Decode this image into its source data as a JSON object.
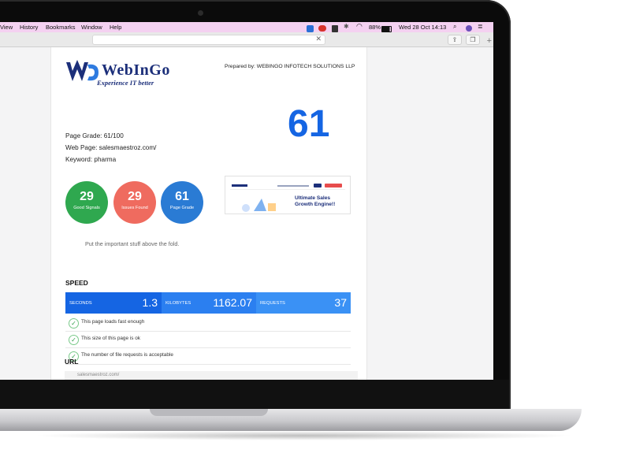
{
  "menubar": {
    "items": [
      "View",
      "History",
      "Bookmarks",
      "Window",
      "Help"
    ],
    "battery": "88%",
    "datetime": "Wed 28 Oct  14:13"
  },
  "browser": {
    "address_value": "",
    "close_glyph": "✕",
    "share_glyph": "⇪",
    "tabs_glyph": "❐",
    "new_tab_glyph": "+"
  },
  "report": {
    "logo_text": "WebInGo",
    "logo_tagline": "Experience IT better",
    "prepared_by": "Prepared by: WEBINGO INFOTECH SOLUTIONS LLP",
    "page_grade_line": "Page Grade: 61/100",
    "web_page_line": "Web Page: salesmaestroz.com/",
    "keyword_line": "Keyword: pharma",
    "grade_big": "61",
    "thumbnail_heading": "Ultimate Sales Growth Engine!!",
    "circles": [
      {
        "value": "29",
        "label": "Good Signals",
        "color": "#2fa84f"
      },
      {
        "value": "29",
        "label": "Issues Found",
        "color": "#ef6b5f"
      },
      {
        "value": "61",
        "label": "Page Grade",
        "color": "#2a7bd4"
      }
    ],
    "fold_tip": "Put the important stuff above the fold.",
    "speed_heading": "SPEED",
    "speed": [
      {
        "label": "SECONDS",
        "value": "1.3",
        "color": "#1565e3"
      },
      {
        "label": "KILOBYTES",
        "value": "1162.07",
        "color": "#2b7ff0"
      },
      {
        "label": "REQUESTS",
        "value": "37",
        "color": "#3a91f5"
      }
    ],
    "checks": [
      "This page loads fast enough",
      "This size of this page is ok",
      "The number of file requests is acceptable"
    ],
    "url_heading": "URL",
    "url_value": "salesmaestroz.com/"
  }
}
